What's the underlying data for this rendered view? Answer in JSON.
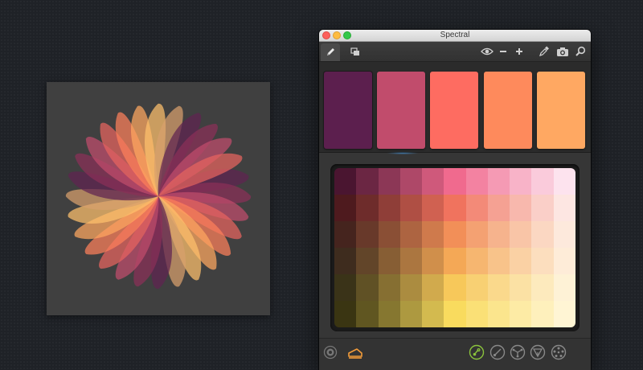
{
  "window": {
    "title": "Spectral"
  },
  "colors": {
    "accent_orange": "#f39c3a",
    "accent_green": "#8ac23c",
    "swatches": [
      "#5c1f4e",
      "#c14c6c",
      "#fe6c61",
      "#fe8a5c",
      "#ffa862"
    ]
  },
  "toolbar": {
    "left_tabs": [
      "pencil-icon",
      "layers-icon"
    ],
    "right_icons": [
      "eye-icon",
      "minus-icon",
      "plus-icon",
      "eyedropper-icon",
      "camera-icon",
      "search-icon"
    ]
  },
  "bottom_bar": {
    "left_icons": [
      "color-wheel-icon",
      "artboard-icon"
    ],
    "right_icons": [
      "gradient-mode-icon",
      "linear-mode-icon",
      "triad-mode-icon",
      "tetrad-mode-icon",
      "pentagon-mode-icon"
    ],
    "active_mode": "gradient-mode-icon"
  },
  "color_grid": {
    "rows": 6,
    "cols": 11,
    "rows_left": [
      "#4a1530",
      "#4e1a1e",
      "#45241e",
      "#3e2c1e",
      "#3a3318",
      "#3a3512"
    ],
    "rows_mid": [
      "#f06a8e",
      "#f0735e",
      "#f28f58",
      "#f4a856",
      "#f7c85a",
      "#f9db5e"
    ],
    "rows_right": [
      "#fde3ee",
      "#fde6e2",
      "#fde9dc",
      "#feecd8",
      "#fef2d6",
      "#fff5d4"
    ]
  },
  "artwork": {
    "petal_colors": [
      "#5f2350",
      "#8a2f58",
      "#c14c6c",
      "#e8645e",
      "#fe7f5a",
      "#ffa860",
      "#ffc06c",
      "#d8a06c"
    ],
    "petal_count": 28
  }
}
